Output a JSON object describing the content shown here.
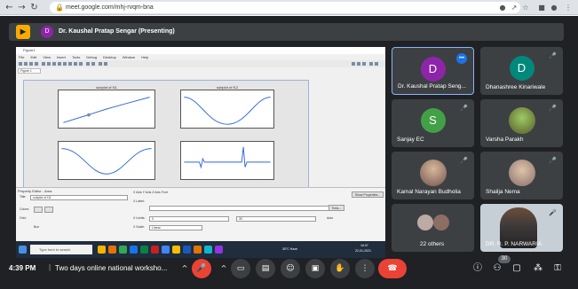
{
  "browser": {
    "url": "meet.google.com/mhj-rvqm-bna",
    "back_icon": "back-arrow-icon",
    "forward_icon": "forward-arrow-icon",
    "reload_icon": "reload-icon"
  },
  "presenting": {
    "avatar_letter": "D",
    "label": "Dr. Kaushal Pratap Sengar (Presenting)"
  },
  "shared_screen": {
    "window_title": "Figure1",
    "menu": [
      "File",
      "Edit",
      "View",
      "Insert",
      "Tools",
      "Debug",
      "Desktop",
      "Window",
      "Help"
    ],
    "figure_tab": "Figure 1",
    "subplot_titles": [
      "subplot of f11",
      "subplot of f12"
    ],
    "property_editor_title": "Property Editor - Area",
    "title_field": "subplot of f11",
    "tabs_label": "X Axis  Y Axis  Z Axis  Font",
    "x_label_caption": "X Label:",
    "x_limits_caption": "X Limits:",
    "x_limits_from": "0",
    "x_limits_to": "30",
    "x_scale_caption": "X Scale:",
    "x_scale_value": "Linear",
    "auto_label": "Auto",
    "show_properties_label": "Show Properties...",
    "ticks_label": "Ticks...",
    "colors_label": "Colors:",
    "grid_label": "Grid:",
    "box_label": "Box",
    "taskbar_search": "Type here to search",
    "taskbar_weather": "30°C Haze",
    "taskbar_time": "16:07",
    "taskbar_date": "22-01-2021"
  },
  "participants": [
    {
      "name": "Dr. Kaushal Pratap Seng...",
      "letter": "D",
      "color": "#8e24aa",
      "type": "avatar",
      "active": true,
      "status_icon": "speaking-icon"
    },
    {
      "name": "Dhanashree Kinariwale",
      "letter": "D",
      "color": "#00897b",
      "type": "avatar",
      "active": false,
      "status_icon": "mic-off-icon"
    },
    {
      "name": "Sanjay EC",
      "letter": "S",
      "color": "#43a047",
      "type": "avatar",
      "active": false,
      "status_icon": "mic-off-icon"
    },
    {
      "name": "Varsha Parakh",
      "letter": "",
      "color": "#6d7a3a",
      "type": "photo",
      "active": false,
      "status_icon": "mic-off-icon"
    },
    {
      "name": "Kamal Narayan Budholia",
      "letter": "",
      "color": "#8d6e63",
      "type": "photo",
      "active": false,
      "status_icon": "mic-off-icon"
    },
    {
      "name": "Shailja Nema",
      "letter": "",
      "color": "#a1887f",
      "type": "photo",
      "active": false,
      "status_icon": "mic-off-icon"
    },
    {
      "name": "22 others",
      "letter": "",
      "color": "#795548",
      "type": "group",
      "active": false,
      "status_icon": ""
    },
    {
      "name": "DR. R. P. NARWARIA",
      "letter": "",
      "color": "#607d8b",
      "type": "video",
      "active": false,
      "status_icon": "mic-off-icon"
    }
  ],
  "bottom_bar": {
    "time": "4:39 PM",
    "separator": "|",
    "meeting_title": "Two days online national worksho...",
    "participant_count": "30"
  }
}
